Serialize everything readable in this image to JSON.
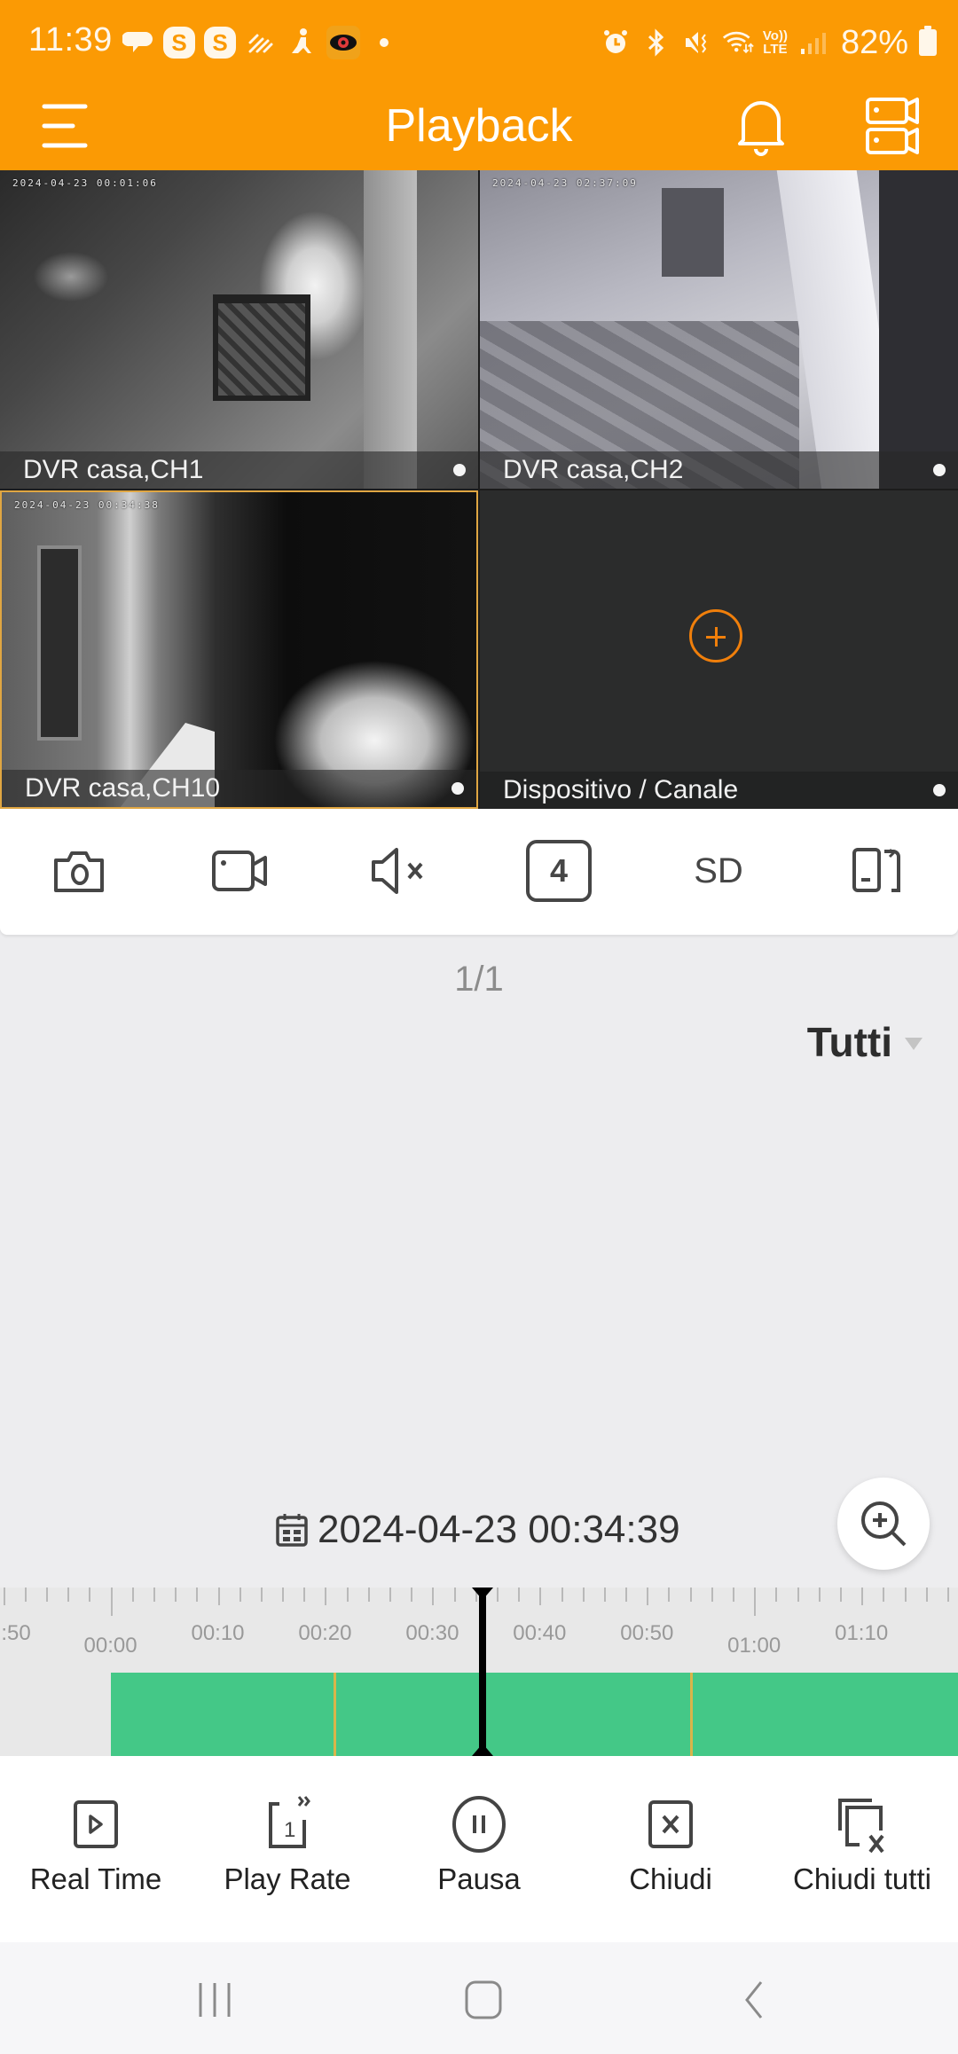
{
  "status_bar": {
    "time": "11:39",
    "left_icons": [
      "chat-bubbles-icon",
      "skype-icon",
      "skype-icon",
      "data-saver-icon",
      "accessibility-icon",
      "eye-app-icon",
      "notification-dot"
    ],
    "right_icons": [
      "alarm-icon",
      "bluetooth-icon",
      "mute-vibrate-icon",
      "wifi-icon",
      "volte-icon",
      "signal-icon",
      "battery-icon"
    ],
    "volte_top": "Vo))",
    "volte_bottom": "LTE",
    "battery": "82%"
  },
  "header": {
    "title": "Playback",
    "menu_icon": "hamburger-menu-icon",
    "bell_icon": "bell-icon",
    "devices_icon": "device-cameras-icon",
    "background_color": "#fb9a04"
  },
  "video_grid": {
    "tiles": [
      {
        "label": "DVR casa,CH1",
        "osd": "2024-04-23 00:01:06",
        "selected": false
      },
      {
        "label": "DVR casa,CH2",
        "osd": "2024-04-23 02:37:09",
        "selected": false
      },
      {
        "label": "DVR casa,CH10",
        "osd": "2024-04-23 00:34:38",
        "selected": true
      },
      {
        "label": "Dispositivo / Canale",
        "osd": "",
        "empty": true
      }
    ],
    "add_icon_color": "#f07f0b",
    "selected_border_color": "#e0a642"
  },
  "toolbar": {
    "snapshot_icon": "camera-icon",
    "record_icon": "video-record-icon",
    "mute_icon": "speaker-muted-icon",
    "split_count": "4",
    "quality": "SD",
    "rotate_icon": "screen-rotate-icon"
  },
  "content": {
    "pager": "1/1",
    "filter_label": "Tutti"
  },
  "playback": {
    "datetime": "2024-04-23 00:34:39",
    "zoom_icon": "zoom-in-icon"
  },
  "timeline": {
    "tick_labels": [
      {
        "text": ":50",
        "minute": -10,
        "major": false
      },
      {
        "text": "00:00",
        "minute": 0,
        "major": true
      },
      {
        "text": "00:10",
        "minute": 10,
        "major": false
      },
      {
        "text": "00:20",
        "minute": 20,
        "major": false
      },
      {
        "text": "00:30",
        "minute": 30,
        "major": false
      },
      {
        "text": "00:40",
        "minute": 40,
        "major": false
      },
      {
        "text": "00:50",
        "minute": 50,
        "major": false
      },
      {
        "text": "01:00",
        "minute": 60,
        "major": true
      },
      {
        "text": "01:10",
        "minute": 70,
        "major": false
      }
    ],
    "recording_start_minute": 0,
    "recording_end_minute": 80,
    "segment_marks_minutes": [
      20.8,
      54
    ],
    "cursor_minute": 34.65,
    "recording_color": "#44c887",
    "visible_range_minutes": [
      -10.3,
      79
    ]
  },
  "actions": [
    {
      "label": "Real Time",
      "icon": "realtime-play-icon"
    },
    {
      "label": "Play Rate",
      "icon": "play-rate-icon"
    },
    {
      "label": "Pausa",
      "icon": "pause-icon"
    },
    {
      "label": "Chiudi",
      "icon": "close-icon"
    },
    {
      "label": "Chiudi tutti",
      "icon": "close-all-icon"
    }
  ],
  "nav_bar": {
    "recents": "recents-icon",
    "home": "home-icon",
    "back": "back-icon"
  }
}
